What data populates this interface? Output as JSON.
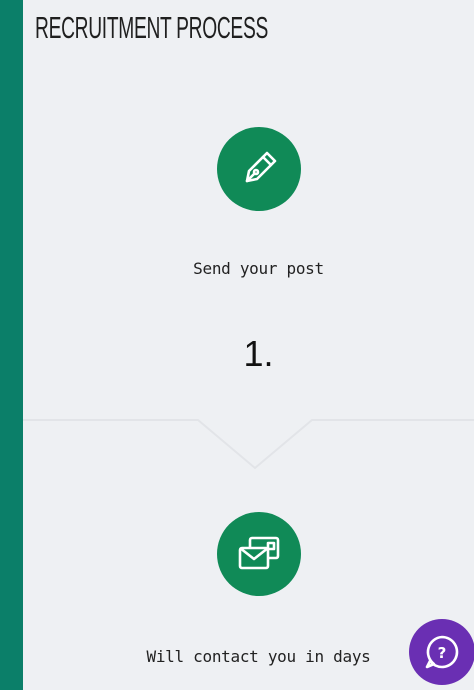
{
  "title": "RECRUITMENT PROCESS",
  "steps": [
    {
      "icon": "pen-nib-icon",
      "label": "Send your post",
      "number": "1."
    },
    {
      "icon": "mail-card-icon",
      "label": "Will contact you in days"
    }
  ],
  "help": {
    "icon": "help-chat-icon",
    "glyph": "?"
  },
  "colors": {
    "sidebar": "#0b7f69",
    "panel": "#eef0f3",
    "icon_circle": "#108a57",
    "help_button": "#6a2fb3"
  }
}
